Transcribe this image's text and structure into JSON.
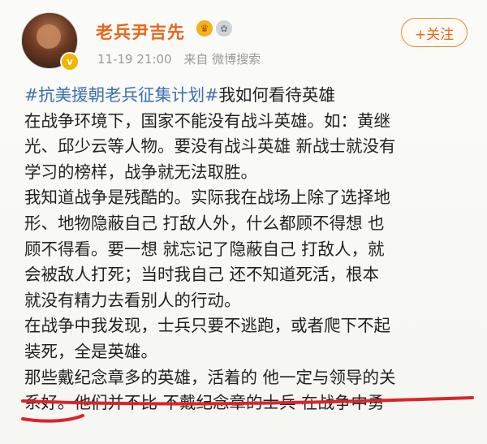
{
  "post": {
    "username": "老兵尹吉先",
    "badges": [
      "crown-icon",
      "medal-icon"
    ],
    "timestamp": "11-19 21:00",
    "source": "来自 微博搜索",
    "follow_label": "+关注",
    "verified_icon": "v",
    "body": {
      "hashtag_1": "#抗美援朝老兵征集计划",
      "hashtag_2": "#",
      "after_hashtag": "我如何看待英雄",
      "lines": [
        "在战争环境下，国家不能没有战斗英雄。如：黄继",
        "光、邱少云等人物。要没有战斗英雄 新战士就没有",
        "学习的榜样，战争就无法取胜。",
        "我知道战争是残酷的。实际我在战场上除了选择地",
        "形、地物隐蔽自己 打敌人外，什么都顾不得想 也",
        "顾不得看。要一想 就忘记了隐蔽自己 打敌人，就",
        "会被敌人打死；当时我自己 还不知道死活，根本",
        "就没有精力去看别人的行动。",
        "在战争中我发现，士兵只要不逃跑，或者爬下不起",
        "装死，全是英雄。",
        "那些戴纪念章多的英雄，活着的 他一定与领导的关",
        "系好。他们并不比 不戴纪念章的士兵 在战争中勇"
      ]
    }
  },
  "colors": {
    "username": "#e8661a",
    "hashtag": "#3a6fb0",
    "underline": "#d8262a"
  }
}
